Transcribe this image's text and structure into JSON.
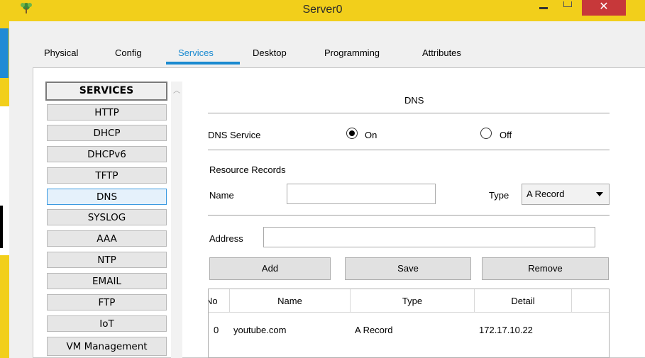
{
  "window": {
    "title": "Server0",
    "close_glyph": "✕",
    "icons": [
      "app-icon",
      "minimize-icon",
      "maximize-icon",
      "close-icon"
    ]
  },
  "tabs": [
    {
      "label": "Physical"
    },
    {
      "label": "Config"
    },
    {
      "label": "Services",
      "active": true
    },
    {
      "label": "Desktop"
    },
    {
      "label": "Programming"
    },
    {
      "label": "Attributes"
    }
  ],
  "services": {
    "header": "SERVICES",
    "items": [
      "HTTP",
      "DHCP",
      "DHCPv6",
      "TFTP",
      "DNS",
      "SYSLOG",
      "AAA",
      "NTP",
      "EMAIL",
      "FTP",
      "IoT",
      "VM Management"
    ],
    "selected": "DNS"
  },
  "dns": {
    "title": "DNS",
    "service_label": "DNS Service",
    "on_label": "On",
    "off_label": "Off",
    "service_state": "On",
    "resource_records_label": "Resource Records",
    "name_label": "Name",
    "name_value": "",
    "type_label": "Type",
    "type_value": "A Record",
    "address_label": "Address",
    "address_value": "",
    "add_label": "Add",
    "save_label": "Save",
    "remove_label": "Remove"
  },
  "records_table": {
    "columns": [
      "No",
      "Name",
      "Type",
      "Detail"
    ],
    "rows": [
      {
        "no": "0",
        "name": "youtube.com",
        "type": "A Record",
        "detail": "172.17.10.22"
      }
    ]
  },
  "colors": {
    "titlebar": "#f2cf1b",
    "accent": "#1b8ad0",
    "close": "#c7383a",
    "selected_item": "#e5f1fb"
  }
}
